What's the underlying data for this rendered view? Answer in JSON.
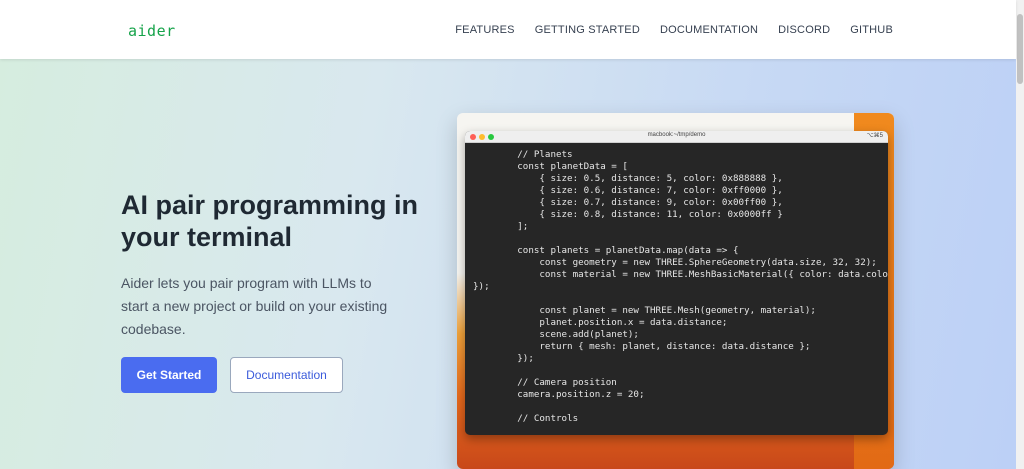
{
  "header": {
    "logo": "aider",
    "nav": [
      "FEATURES",
      "GETTING STARTED",
      "DOCUMENTATION",
      "DISCORD",
      "GITHUB"
    ]
  },
  "hero": {
    "headline": "AI pair programming in your terminal",
    "subtext": "Aider lets you pair program with LLMs to start a new project or build on your existing codebase.",
    "primary_button": "Get Started",
    "secondary_button": "Documentation"
  },
  "terminal": {
    "title": "macbook:~/tmp/demo",
    "shortcut": "⌥⌘5",
    "code": "        // Planets\n        const planetData = [\n            { size: 0.5, distance: 5, color: 0x888888 },\n            { size: 0.6, distance: 7, color: 0xff0000 },\n            { size: 0.7, distance: 9, color: 0x00ff00 },\n            { size: 0.8, distance: 11, color: 0x0000ff }\n        ];\n\n        const planets = planetData.map(data => {\n            const geometry = new THREE.SphereGeometry(data.size, 32, 32);\n            const material = new THREE.MeshBasicMaterial({ color: data.color\n});\n\n            const planet = new THREE.Mesh(geometry, material);\n            planet.position.x = data.distance;\n            scene.add(planet);\n            return { mesh: planet, distance: data.distance };\n        });\n\n        // Camera position\n        camera.position.z = 20;\n\n        // Controls"
  }
}
